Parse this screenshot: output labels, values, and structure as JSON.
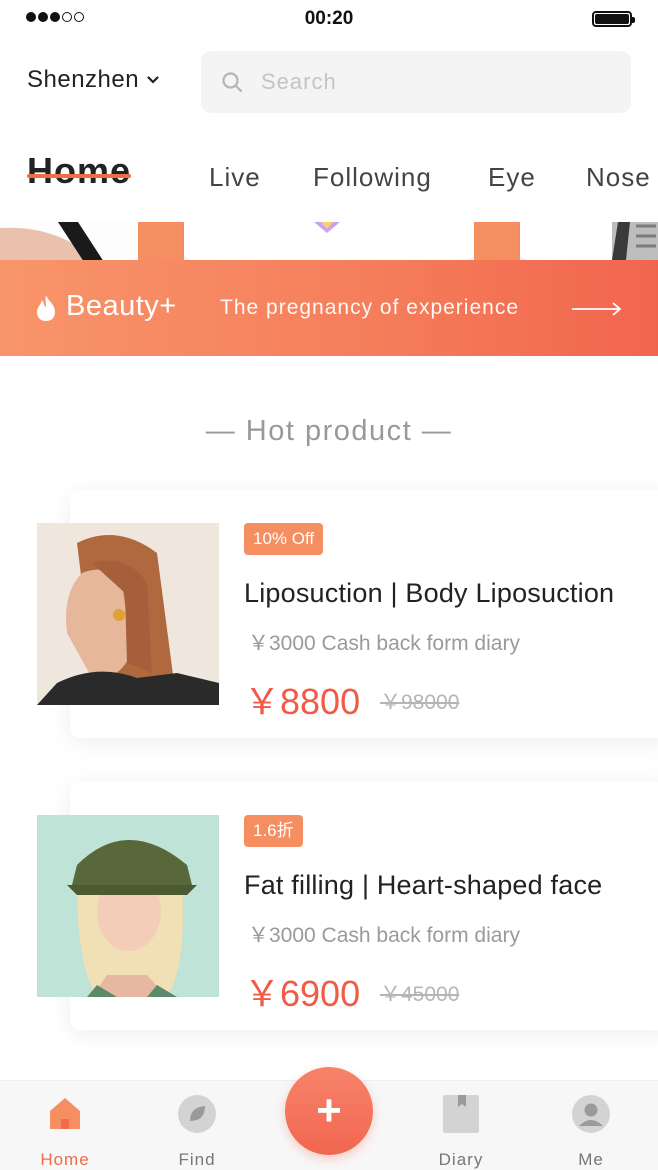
{
  "status_bar": {
    "time": "00:20"
  },
  "header": {
    "city": "Shenzhen",
    "search_placeholder": "Search"
  },
  "tabs": [
    {
      "label": "Home",
      "active": true
    },
    {
      "label": "Live"
    },
    {
      "label": "Following"
    },
    {
      "label": "Eye"
    },
    {
      "label": "Nose"
    }
  ],
  "banner": {
    "brand": "Beauty+",
    "slogan": "The pregnancy of experience"
  },
  "section_title": "— Hot product —",
  "products": [
    {
      "badge": "10% Off",
      "name": "Liposuction | Body Liposuction",
      "cashback": "￥3000 Cash back form diary",
      "price": "￥8800",
      "old_price": "￥98000"
    },
    {
      "badge": "1.6折",
      "name": "Fat filling | Heart-shaped face",
      "cashback": "￥3000 Cash back form diary",
      "price": "￥6900",
      "old_price": "￥45000"
    }
  ],
  "tabbar": {
    "items": [
      {
        "label": "Home",
        "icon": "home-icon",
        "active": true
      },
      {
        "label": "Find",
        "icon": "leaf-icon"
      },
      {
        "label": "Diary",
        "icon": "bookmark-icon"
      },
      {
        "label": "Me",
        "icon": "user-icon"
      }
    ],
    "fab_label": "+"
  },
  "colors": {
    "accent": "#f26b4a",
    "badge": "#f58f62",
    "price": "#f25a45"
  }
}
